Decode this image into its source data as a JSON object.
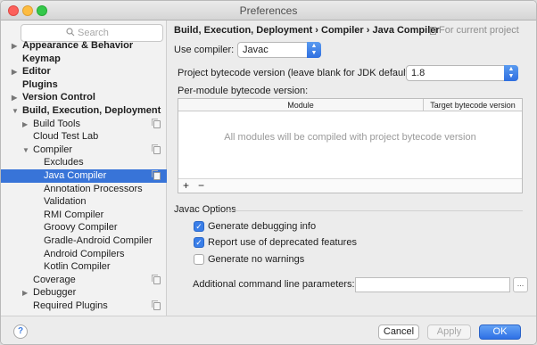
{
  "window": {
    "title": "Preferences"
  },
  "sidebar": {
    "search_placeholder": "Search",
    "items": [
      {
        "label": "Appearance & Behavior",
        "bold": true,
        "arrow": "right",
        "indent": 0
      },
      {
        "label": "Keymap",
        "bold": true,
        "arrow": "",
        "indent": 0
      },
      {
        "label": "Editor",
        "bold": true,
        "arrow": "right",
        "indent": 0
      },
      {
        "label": "Plugins",
        "bold": true,
        "arrow": "",
        "indent": 0
      },
      {
        "label": "Version Control",
        "bold": true,
        "arrow": "right",
        "indent": 0
      },
      {
        "label": "Build, Execution, Deployment",
        "bold": true,
        "arrow": "down",
        "indent": 0
      },
      {
        "label": "Build Tools",
        "bold": false,
        "arrow": "right",
        "indent": 1,
        "copy": true
      },
      {
        "label": "Cloud Test Lab",
        "bold": false,
        "arrow": "",
        "indent": 1
      },
      {
        "label": "Compiler",
        "bold": false,
        "arrow": "down",
        "indent": 1,
        "copy": true
      },
      {
        "label": "Excludes",
        "bold": false,
        "arrow": "",
        "indent": 2
      },
      {
        "label": "Java Compiler",
        "bold": false,
        "arrow": "",
        "indent": 2,
        "selected": true,
        "copy": true
      },
      {
        "label": "Annotation Processors",
        "bold": false,
        "arrow": "",
        "indent": 2
      },
      {
        "label": "Validation",
        "bold": false,
        "arrow": "",
        "indent": 2
      },
      {
        "label": "RMI Compiler",
        "bold": false,
        "arrow": "",
        "indent": 2
      },
      {
        "label": "Groovy Compiler",
        "bold": false,
        "arrow": "",
        "indent": 2
      },
      {
        "label": "Gradle-Android Compiler",
        "bold": false,
        "arrow": "",
        "indent": 2
      },
      {
        "label": "Android Compilers",
        "bold": false,
        "arrow": "",
        "indent": 2
      },
      {
        "label": "Kotlin Compiler",
        "bold": false,
        "arrow": "",
        "indent": 2
      },
      {
        "label": "Coverage",
        "bold": false,
        "arrow": "",
        "indent": 1,
        "copy": true
      },
      {
        "label": "Debugger",
        "bold": false,
        "arrow": "right",
        "indent": 1
      },
      {
        "label": "Required Plugins",
        "bold": false,
        "arrow": "",
        "indent": 1,
        "copy": true
      }
    ]
  },
  "header": {
    "breadcrumb": "Build, Execution, Deployment › Compiler › Java Compiler",
    "scope": "For current project"
  },
  "form": {
    "use_compiler_label": "Use compiler:",
    "use_compiler_value": "Javac",
    "bytecode_label": "Project bytecode version (leave blank for JDK default):",
    "bytecode_value": "1.8",
    "per_module_label": "Per-module bytecode version:"
  },
  "table": {
    "columns": [
      "Module",
      "Target bytecode version"
    ],
    "empty_text": "All modules will be compiled with project bytecode version",
    "add_label": "+",
    "remove_label": "−"
  },
  "javac": {
    "section_title": "Javac Options",
    "options": [
      {
        "label": "Generate debugging info",
        "checked": true
      },
      {
        "label": "Report use of deprecated features",
        "checked": true
      },
      {
        "label": "Generate no warnings",
        "checked": false
      }
    ],
    "params_label": "Additional command line parameters:",
    "params_value": "",
    "browse_label": "..."
  },
  "footer": {
    "help_label": "?",
    "cancel_label": "Cancel",
    "apply_label": "Apply",
    "ok_label": "OK"
  }
}
